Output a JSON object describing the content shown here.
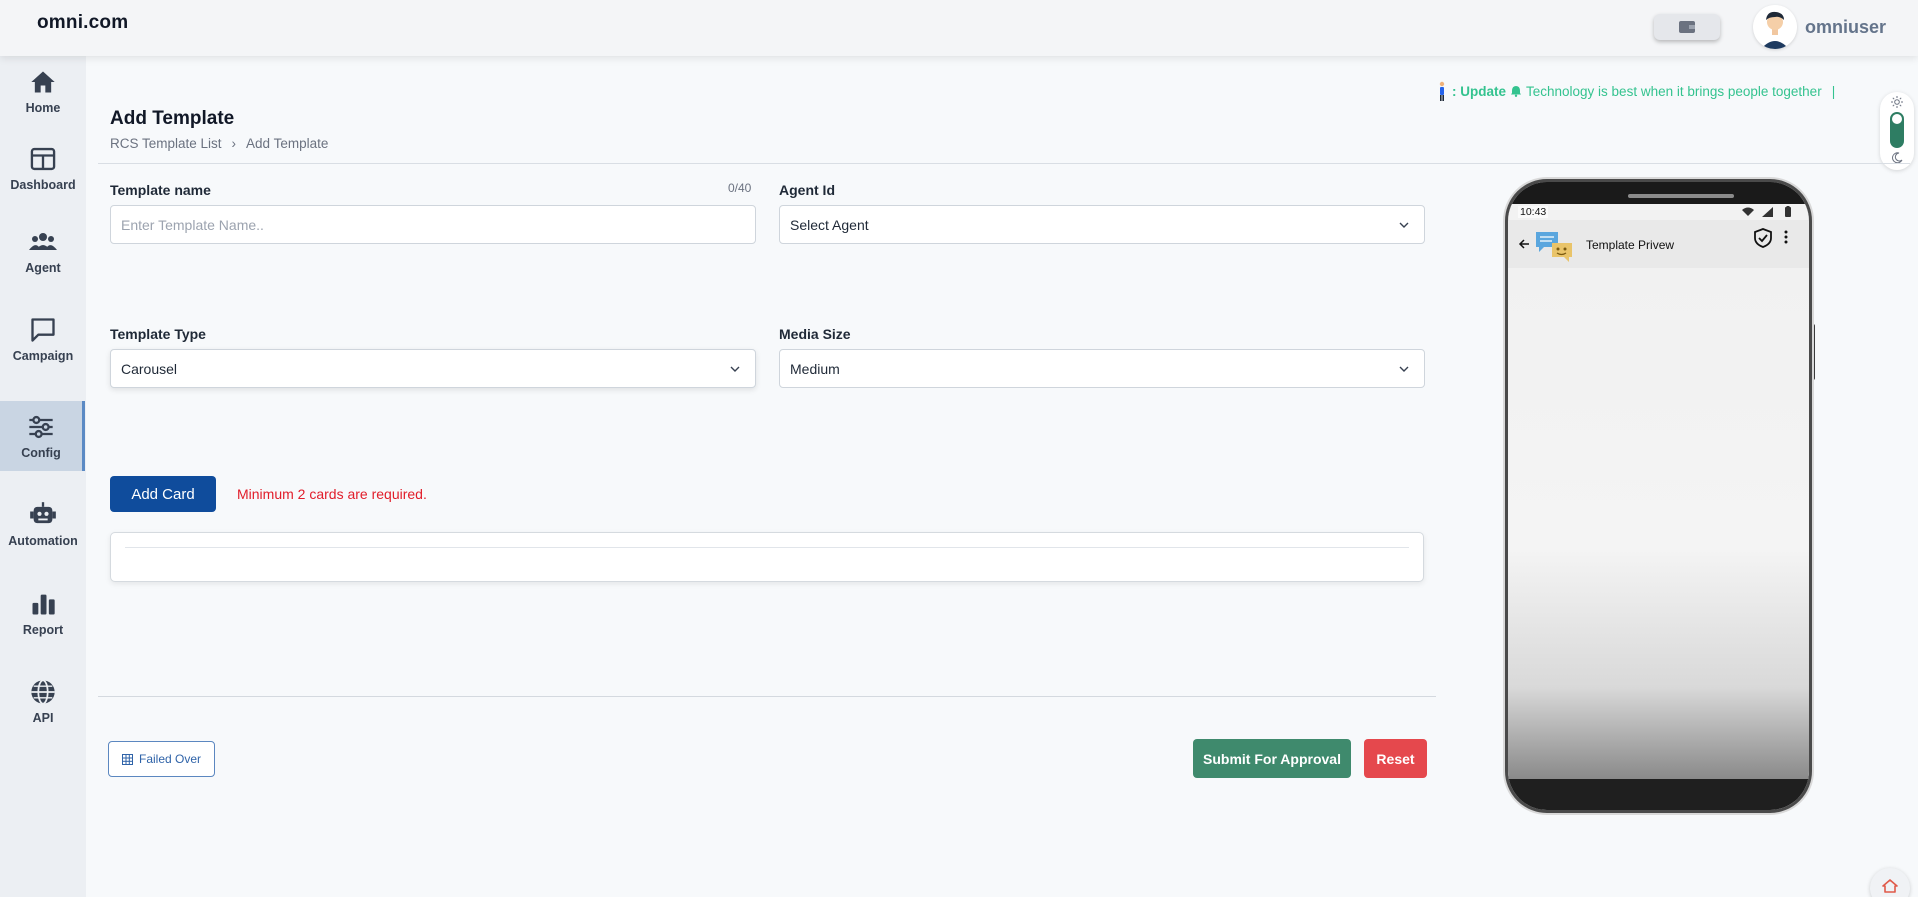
{
  "app": {
    "logo": "omni.com",
    "username": "omniuser"
  },
  "sidebar": {
    "items": [
      {
        "label": "Home",
        "icon": "home-icon"
      },
      {
        "label": "Dashboard",
        "icon": "dashboard-icon"
      },
      {
        "label": "Agent",
        "icon": "agent-icon"
      },
      {
        "label": "Campaign",
        "icon": "campaign-icon"
      },
      {
        "label": "Config",
        "icon": "config-icon",
        "active": true
      },
      {
        "label": "Automation",
        "icon": "automation-icon"
      },
      {
        "label": "Report",
        "icon": "report-icon"
      },
      {
        "label": "API",
        "icon": "api-icon"
      }
    ]
  },
  "ticker": {
    "prefix": ": Update",
    "message": "Technology is best when it brings people together",
    "cursor": "|"
  },
  "page": {
    "title": "Add Template",
    "breadcrumb": [
      "RCS Template List",
      "›",
      "Add Template"
    ]
  },
  "form": {
    "template_name": {
      "label": "Template name",
      "placeholder": "Enter Template Name..",
      "counter": "0/40"
    },
    "agent_id": {
      "label": "Agent Id",
      "value": "Select Agent"
    },
    "template_type": {
      "label": "Template Type",
      "value": "Carousel"
    },
    "media_size": {
      "label": "Media Size",
      "value": "Medium"
    },
    "add_card_label": "Add Card",
    "warning": "Minimum 2 cards are required."
  },
  "actions": {
    "failed_over": "Failed Over",
    "submit": "Submit For Approval",
    "reset": "Reset"
  },
  "preview": {
    "time": "10:43",
    "title": "Template Privew"
  },
  "colors": {
    "primary": "#0f4c9c",
    "success": "#3f8a6d",
    "danger": "#e5484d",
    "ticker": "#34c38f",
    "warning_text": "#e11d2a"
  }
}
